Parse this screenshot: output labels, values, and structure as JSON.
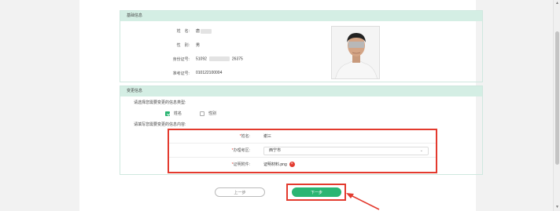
{
  "section_basic": {
    "title": "基础信息",
    "rows": [
      {
        "label": "姓　名:",
        "value": "唐"
      },
      {
        "label": "性　别:",
        "value": "男"
      },
      {
        "label": "身份证号:",
        "value_prefix": "51092",
        "value_suffix": "26375"
      },
      {
        "label": "准考证号:",
        "value": "010122100004"
      }
    ]
  },
  "section_change": {
    "title": "变更信息",
    "question_type": "请选择您需要变更的信息类型:",
    "options": [
      {
        "label": "姓名",
        "checked": true
      },
      {
        "label": "性别",
        "checked": false
      }
    ],
    "question_content": "请填写您需要变更的信息内容:",
    "form": {
      "name_label": "姓名:",
      "name_value": "谢三",
      "place_label": "办理考区:",
      "place_value": "西宁市",
      "attachment_label": "证明附件:",
      "attachment_value": "证明材料.png",
      "required_mark": "*"
    }
  },
  "buttons": {
    "prev": "上一步",
    "next": "下一步"
  },
  "colors": {
    "accent": "#2bb573",
    "highlight": "#e33a2e",
    "header_bg": "#d4eee4"
  }
}
